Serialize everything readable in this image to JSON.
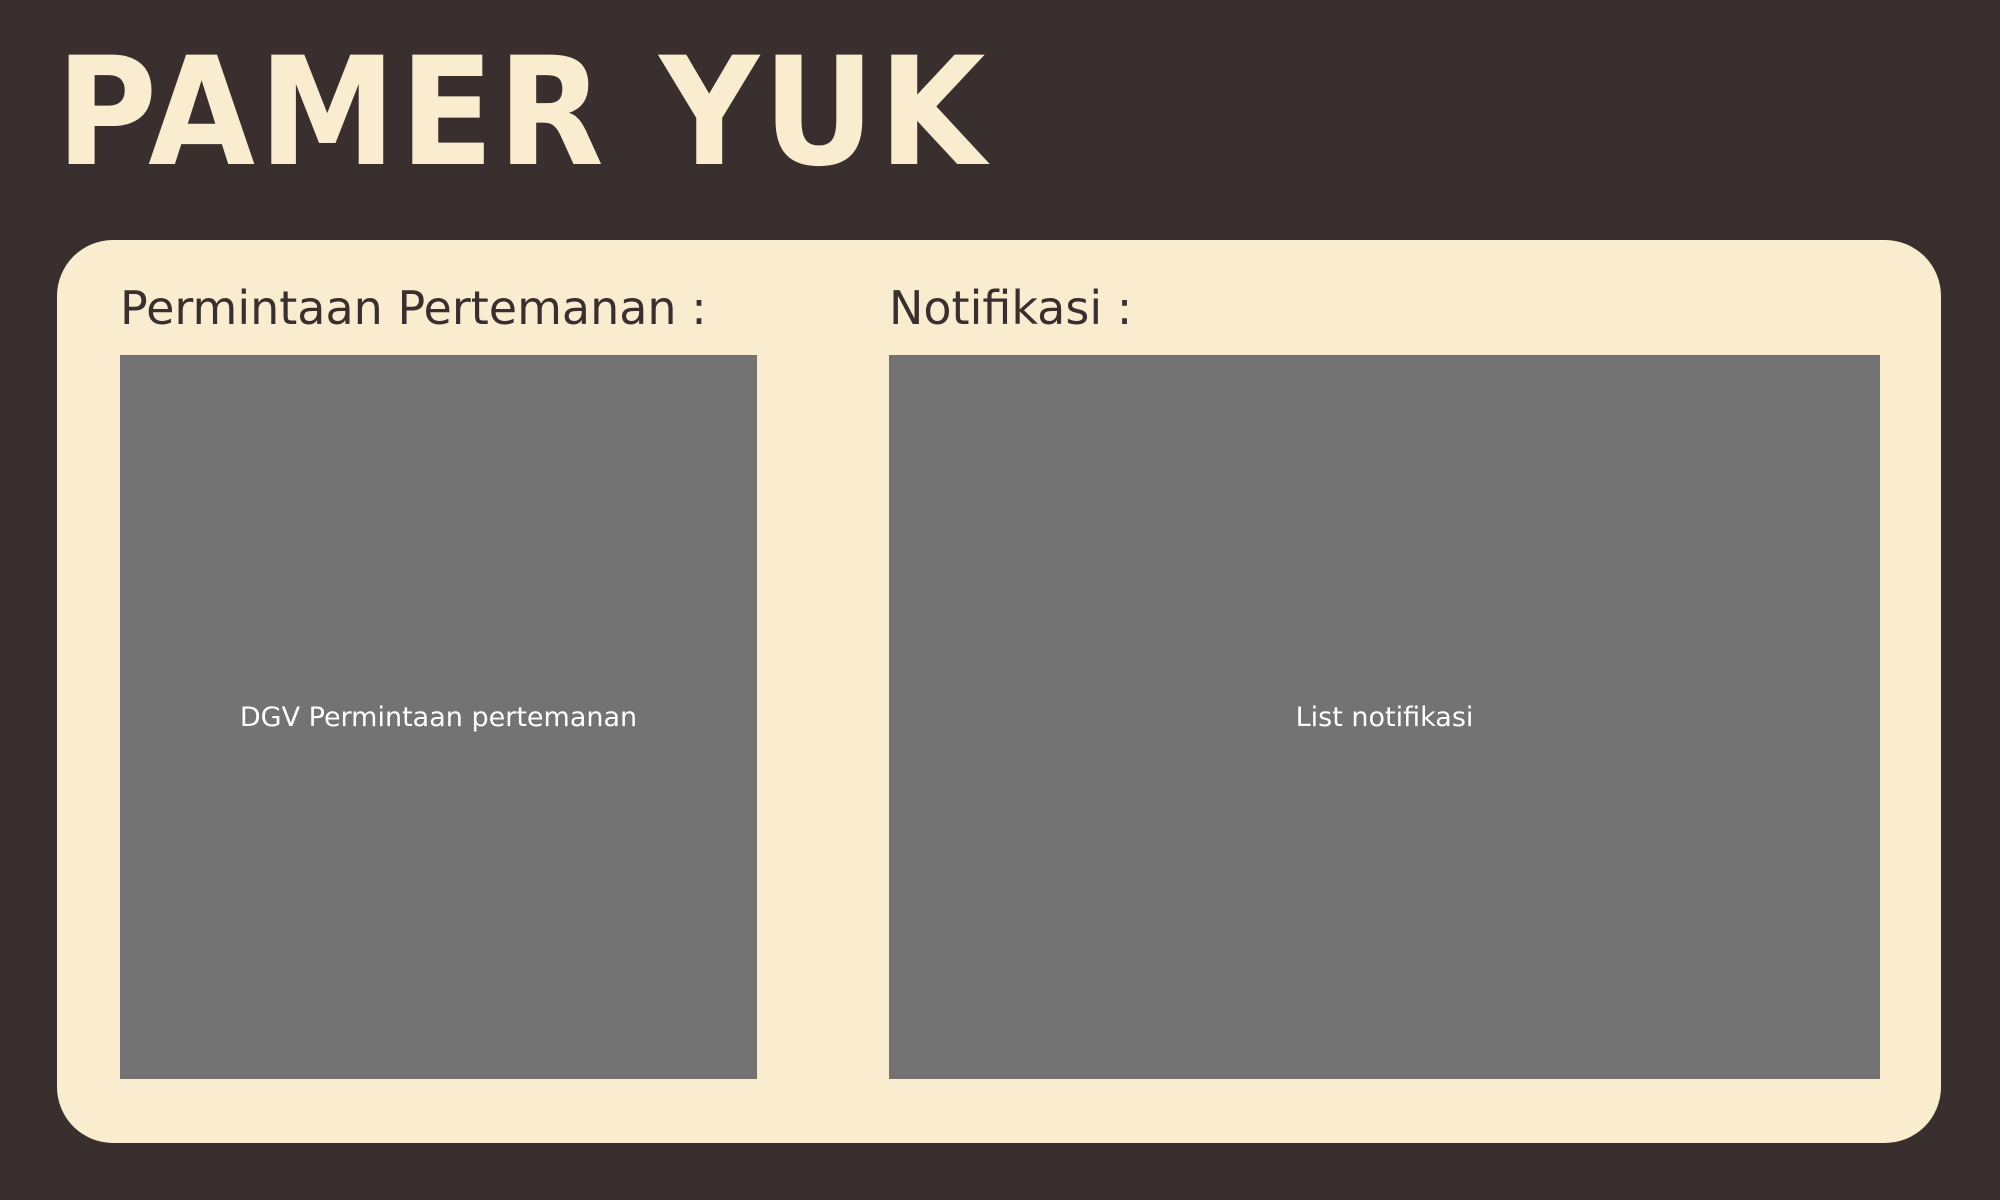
{
  "app": {
    "title": "PAMER YUK"
  },
  "friend_requests": {
    "heading": "Permintaan Pertemanan :",
    "grid_label": "DGV Permintaan pertemanan"
  },
  "notifications": {
    "heading": "Notifikasi :",
    "list_label": "List notifikasi"
  },
  "colors": {
    "background": "#3a2f2f",
    "panel": "#faedcf",
    "title_text": "#f9eccf",
    "placeholder": "#737373",
    "heading_text": "#3a2f2f"
  }
}
